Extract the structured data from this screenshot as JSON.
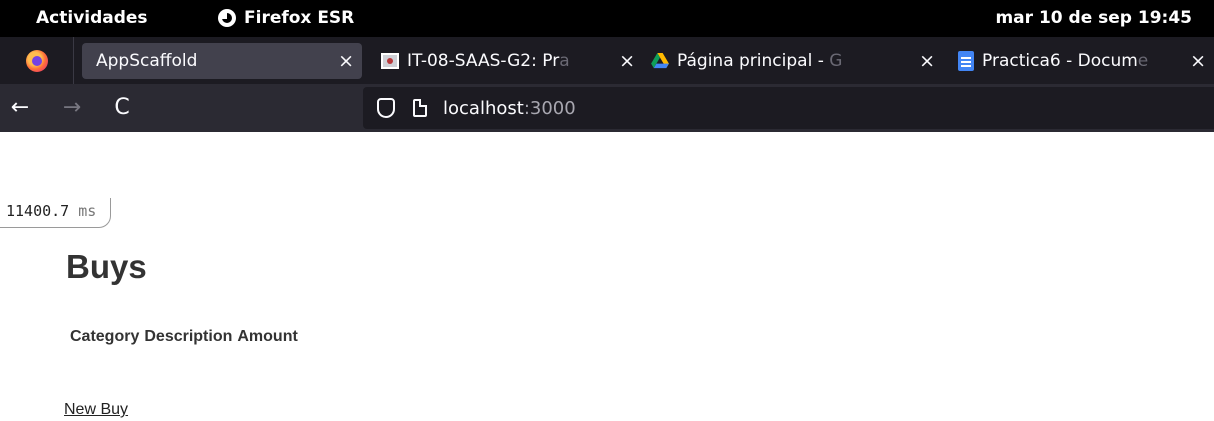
{
  "topbar": {
    "activities": "Actividades",
    "app_name": "Firefox ESR",
    "clock": "mar 10 de sep  19:45"
  },
  "tabs": [
    {
      "title": "AppScaffold",
      "close": "×",
      "active": true
    },
    {
      "title": "IT-08-SAAS-G2: Pr",
      "title_fade": "a",
      "close": "×",
      "icon": "image-favicon-icon"
    },
    {
      "title": "Página principal - ",
      "title_fade": "G",
      "close": "×",
      "icon": "google-drive-icon"
    },
    {
      "title": "Practica6 - Docum",
      "title_fade": "e",
      "close": "×",
      "icon": "google-docs-icon"
    }
  ],
  "nav": {
    "back": "←",
    "forward": "→",
    "reload": "C",
    "url_host": "localhost",
    "url_port": ":3000"
  },
  "page": {
    "timer_value": "11400.7",
    "timer_unit": "ms",
    "title": "Buys",
    "columns": [
      "Category",
      "Description",
      "Amount"
    ],
    "new_link": "New Buy"
  },
  "colors": {
    "topbar_bg": "#000000",
    "tabstrip_bg": "#1c1b22",
    "active_tab_bg": "#42414d",
    "navbar_bg": "#2b2a33",
    "page_text": "#333333"
  }
}
